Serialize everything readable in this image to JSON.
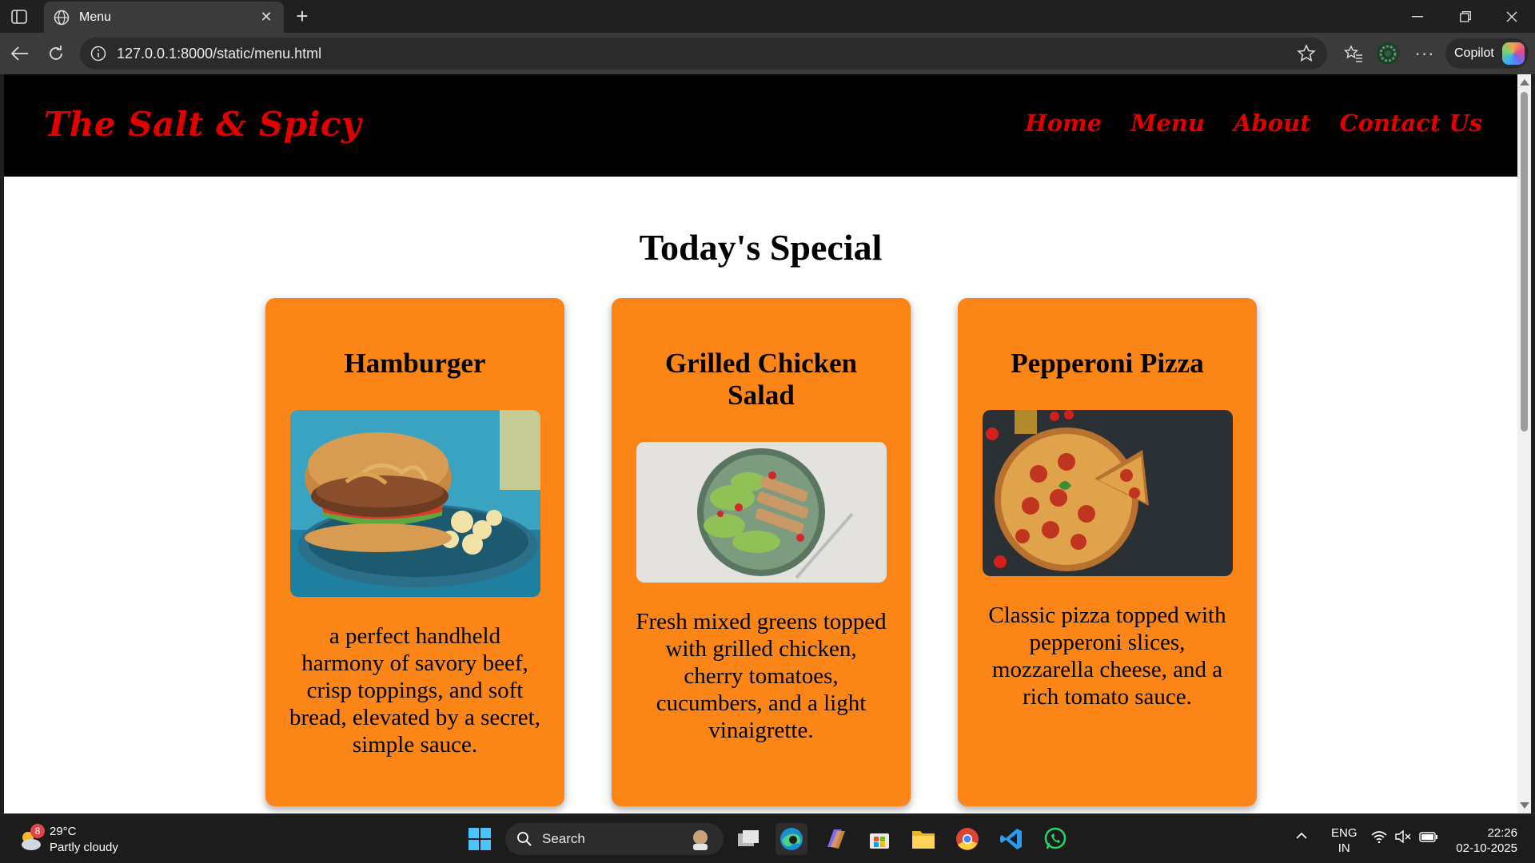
{
  "browser": {
    "tab_title": "Menu",
    "url": "127.0.0.1:8000/static/menu.html",
    "copilot_label": "Copilot"
  },
  "site": {
    "brand": "The Salt & Spicy",
    "nav": [
      "Home",
      "Menu",
      "About",
      "Contact Us"
    ],
    "section_title": "Today's Special",
    "cards": [
      {
        "title": "Hamburger",
        "description": "a perfect handheld harmony of savory beef, crisp toppings, and soft bread, elevated by a secret, simple sauce."
      },
      {
        "title": "Grilled Chicken Salad",
        "description": "Fresh mixed greens topped with grilled chicken, cherry tomatoes, cucumbers, and a light vinaigrette."
      },
      {
        "title": "Pepperoni Pizza",
        "description": "Classic pizza topped with pepperoni slices, mozzarella cheese, and a rich tomato sauce."
      }
    ],
    "colors": {
      "header_bg": "#000000",
      "brand_red": "#e00000",
      "card_orange": "#fc8518"
    }
  },
  "taskbar": {
    "weather_temp": "29°C",
    "weather_desc": "Partly cloudy",
    "weather_badge": "8",
    "search_label": "Search",
    "lang_1": "ENG",
    "lang_2": "IN",
    "time": "22:26",
    "date": "02-10-2025"
  }
}
